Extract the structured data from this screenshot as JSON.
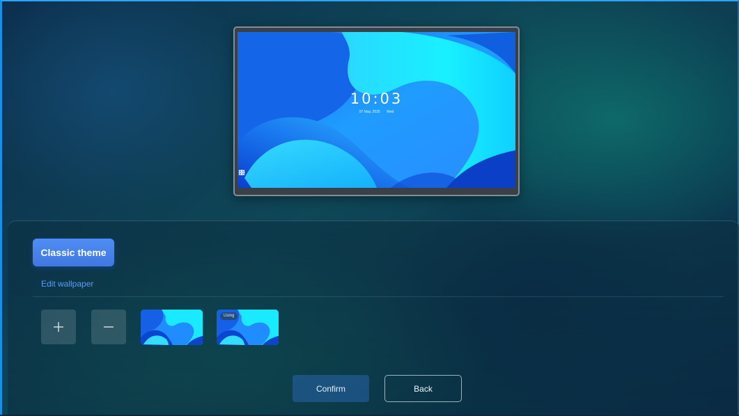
{
  "preview": {
    "time": "10:03",
    "date": "07 May, 2025",
    "weekday": "Wed",
    "dock_icons": [
      "menu-icon",
      "settings-icon",
      "apps-grid-icon"
    ]
  },
  "theme_tabs": [
    {
      "label": "Classic theme",
      "selected": true
    }
  ],
  "edit_wallpaper_label": "Edit wallpaper",
  "wallpaper_actions": {
    "add_icon": "plus-icon",
    "remove_icon": "minus-icon"
  },
  "wallpapers": [
    {
      "name": "wallpaper-thumbnail-1",
      "in_use": false
    },
    {
      "name": "wallpaper-thumbnail-2",
      "in_use": true,
      "badge": "Using"
    }
  ],
  "buttons": {
    "confirm": "Confirm",
    "back": "Back"
  },
  "colors": {
    "accent": "#4f8df4",
    "link": "#5d9cf2",
    "wallpaper_primary": "#14c8ff",
    "wallpaper_dark": "#0b4fd8"
  }
}
